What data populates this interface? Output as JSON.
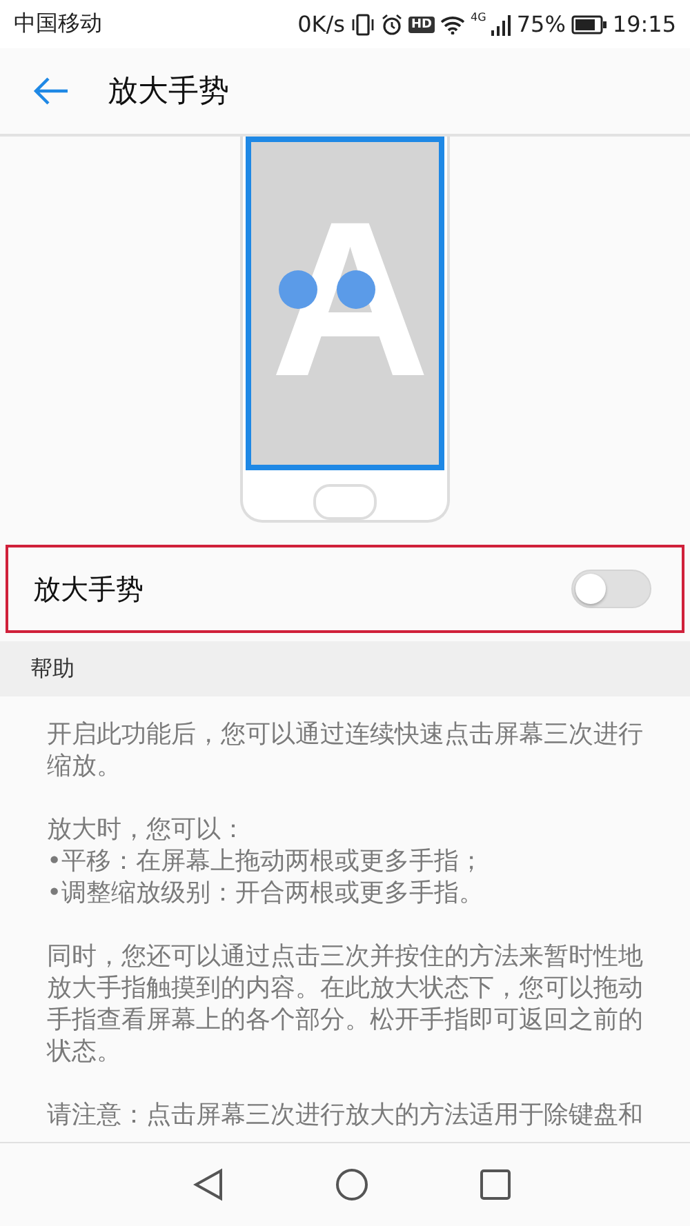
{
  "status_bar": {
    "carrier": "中国移动",
    "speed": "0K/s",
    "hd_badge": "HD",
    "network": "4G",
    "battery": "75%",
    "time": "19:15"
  },
  "header": {
    "title": "放大手势"
  },
  "illustration": {
    "letter": "A"
  },
  "setting": {
    "label": "放大手势",
    "on": false,
    "highlighted": true
  },
  "help": {
    "title": "帮助",
    "paragraphs": [
      [
        "开启此功能后，您可以通过连续快速点击屏幕三次进行缩放。"
      ],
      [
        "放大时，您可以：",
        "•平移：在屏幕上拖动两根或更多手指；",
        "•调整缩放级别：开合两根或更多手指。"
      ],
      [
        "同时，您还可以通过点击三次并按住的方法来暂时性地放大手指触摸到的内容。在此放大状态下，您可以拖动手指查看屏幕上的各个部分。松开手指即可返回之前的状态。"
      ],
      [
        "请注意：点击屏幕三次进行放大的方法适用于除键盘和"
      ]
    ]
  }
}
